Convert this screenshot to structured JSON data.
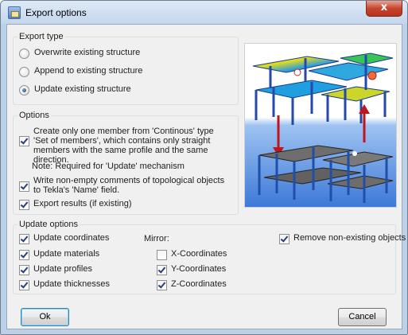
{
  "window": {
    "title": "Export options",
    "close_label": "x"
  },
  "export_type": {
    "title": "Export type",
    "options": [
      {
        "label": "Overwrite existing structure",
        "checked": false
      },
      {
        "label": "Append to existing structure",
        "checked": false
      },
      {
        "label": "Update existing structure",
        "checked": true
      }
    ]
  },
  "options": {
    "title": "Options",
    "items": [
      {
        "label": "Create only one member from 'Continous' type 'Set of members', which contains only straight members with the same profile and the same direction.",
        "checked": true
      },
      {
        "label": "Write non-empty comments of topological objects to Tekla's 'Name' field.",
        "checked": true
      },
      {
        "label": "Export results (if existing)",
        "checked": true
      }
    ],
    "note": "Note: Required for 'Update' mechanism"
  },
  "update_options": {
    "title": "Update options",
    "left": [
      {
        "label": "Update coordinates",
        "checked": true
      },
      {
        "label": "Update materials",
        "checked": true
      },
      {
        "label": "Update profiles",
        "checked": true
      },
      {
        "label": "Update thicknesses",
        "checked": true
      }
    ],
    "mirror_label": "Mirror:",
    "mirror": [
      {
        "label": "X-Coordinates",
        "checked": false
      },
      {
        "label": "Y-Coordinates",
        "checked": true
      },
      {
        "label": "Z-Coordinates",
        "checked": true
      }
    ],
    "remove": {
      "label": "Remove non-existing objects",
      "checked": true
    }
  },
  "buttons": {
    "ok": "Ok",
    "cancel": "Cancel"
  },
  "colors": {
    "arrow_red": "#c0161b",
    "steel_blue": "#1f4fa8",
    "floor_gray": "#6a6a6a"
  }
}
